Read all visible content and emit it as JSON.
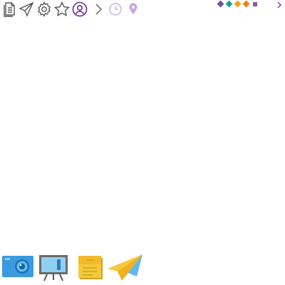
{
  "toolbar": {
    "icons": [
      "document-icon",
      "send-icon",
      "gear-icon",
      "star-icon",
      "user-circle-icon",
      "chevron-right-icon",
      "clock-icon",
      "location-pin-icon"
    ],
    "more_icon": "chevron-right-icon"
  },
  "color_dots": [
    "#7b4fa0",
    "#1aa58a",
    "#f0a31a",
    "#f07e1a",
    "#8a5aa8"
  ],
  "dock": {
    "apps": [
      "camera-app-icon",
      "whiteboard-app-icon",
      "notes-app-icon",
      "paper-plane-app-icon"
    ]
  },
  "colors": {
    "icon_dark": "#555555",
    "accent_purple": "#7a3fa0",
    "light_purple": "#c9a6dc"
  }
}
